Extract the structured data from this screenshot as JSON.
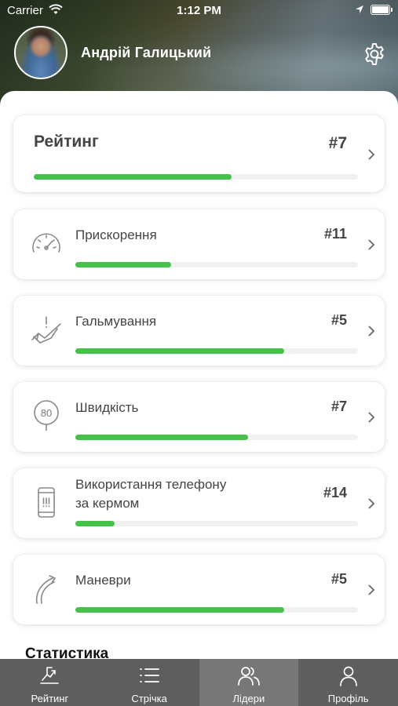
{
  "status_bar": {
    "carrier": "Carrier",
    "time": "1:12 PM"
  },
  "profile": {
    "name": "Андрій Галицький"
  },
  "rating": {
    "title": "Рейтинг",
    "rank": "#7",
    "progress": 0.61
  },
  "categories": [
    {
      "title": "Прискорення",
      "rank": "#11",
      "progress": 0.34,
      "icon": "speedometer-icon"
    },
    {
      "title": "Гальмування",
      "rank": "#5",
      "progress": 0.74,
      "icon": "braking-icon"
    },
    {
      "title": "Швидкість",
      "rank": "#7",
      "progress": 0.61,
      "icon": "speed-sign-icon"
    },
    {
      "title": "Використання телефону\nза кермом",
      "title_line1": "Використання телефону",
      "title_line2": "за кермом",
      "rank": "#14",
      "progress": 0.14,
      "icon": "phone-icon"
    },
    {
      "title": "Маневри",
      "rank": "#5",
      "progress": 0.74,
      "icon": "maneuver-icon"
    }
  ],
  "statistics": {
    "title": "Статистика"
  },
  "tabbar": {
    "active": "leaders",
    "items": [
      {
        "key": "rating",
        "label": "Рейтинг",
        "icon": "rating-icon"
      },
      {
        "key": "feed",
        "label": "Стрічка",
        "icon": "list-icon"
      },
      {
        "key": "leaders",
        "label": "Лідери",
        "icon": "users-icon"
      },
      {
        "key": "profile",
        "label": "Профіль",
        "icon": "person-icon"
      }
    ]
  },
  "colors": {
    "progress": "#46c14a",
    "track": "#f1f1f1",
    "tabbar": "#5e5e5e",
    "tab_active": "#777777"
  }
}
